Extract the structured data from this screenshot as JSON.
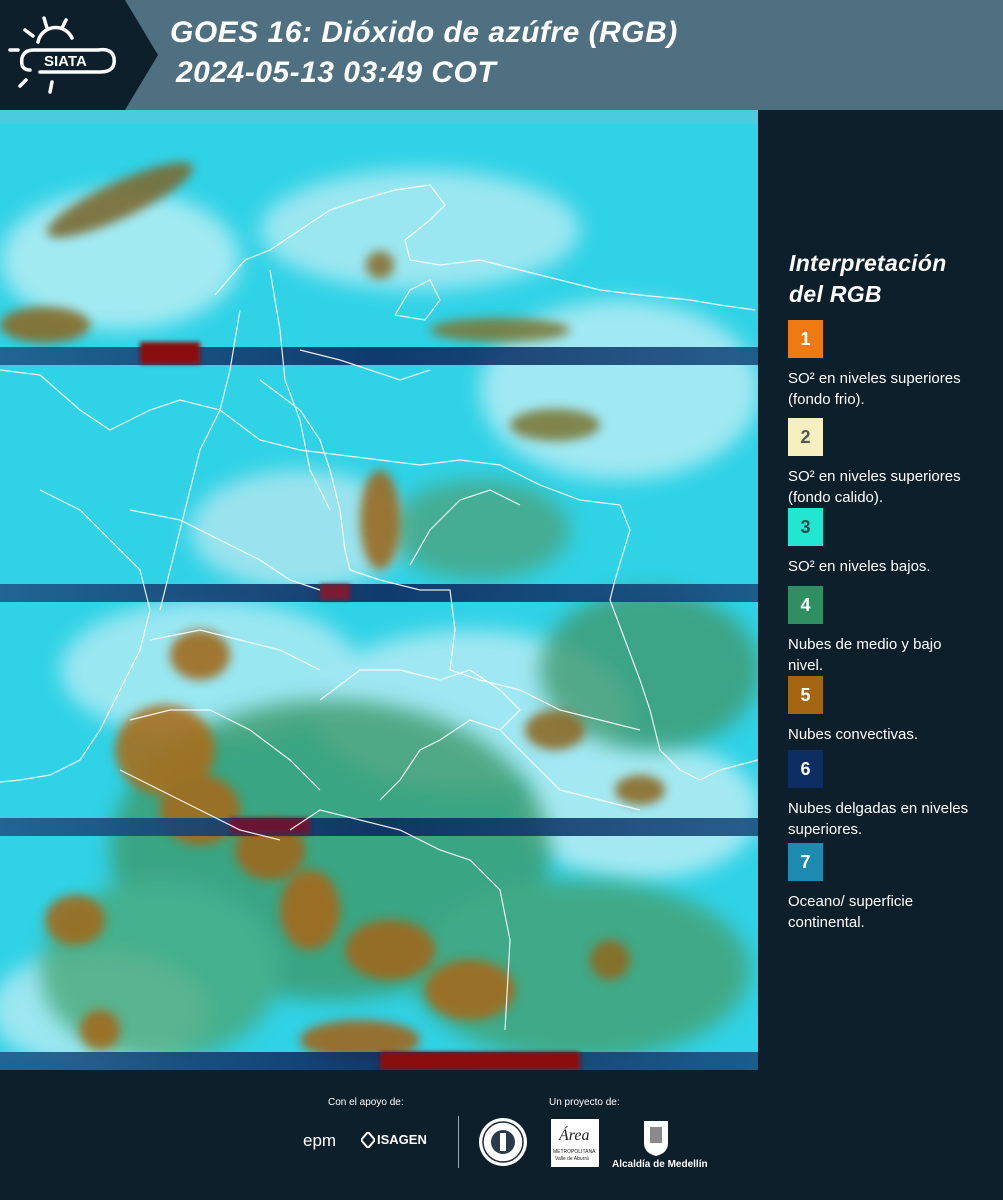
{
  "header": {
    "logo_text": "SIATA",
    "title_line1": "GOES 16: Dióxido de azúfre (RGB)",
    "title_line2": "2024-05-13 03:49 COT"
  },
  "legend": {
    "title_line1": "Interpretación",
    "title_line2": "del RGB",
    "items": [
      {
        "number": "1",
        "color": "#f07a12",
        "text": "SO² en niveles superiores (fondo frio)."
      },
      {
        "number": "2",
        "color": "#f6f0c0",
        "text": "SO² en niveles superiores (fondo calido)."
      },
      {
        "number": "3",
        "color": "#22e6d0",
        "text": "SO² en niveles bajos."
      },
      {
        "number": "4",
        "color": "#2f8f63",
        "text": "Nubes de medio y bajo nivel."
      },
      {
        "number": "5",
        "color": "#a3650f",
        "text": "Nubes convectivas."
      },
      {
        "number": "6",
        "color": "#0d2e63",
        "text": "Nubes delgadas en niveles superiores."
      },
      {
        "number": "7",
        "color": "#1d8bb0",
        "text": "Oceano/ superficie continental."
      }
    ]
  },
  "footer": {
    "support_label": "Con el apoyo de:",
    "project_label": "Un proyecto de:",
    "epm": "epm",
    "isagen": "ISAGEN",
    "area_name": "Área",
    "area_sub1": "METROPOLITANA",
    "area_sub2": "Valle de Aburrá",
    "alcaldia": "Alcaldía de Medellín"
  },
  "colors": {
    "header_bg": "#4e7080",
    "panel_bg": "#0e1f2c",
    "map_base": "#2fd3e6"
  }
}
